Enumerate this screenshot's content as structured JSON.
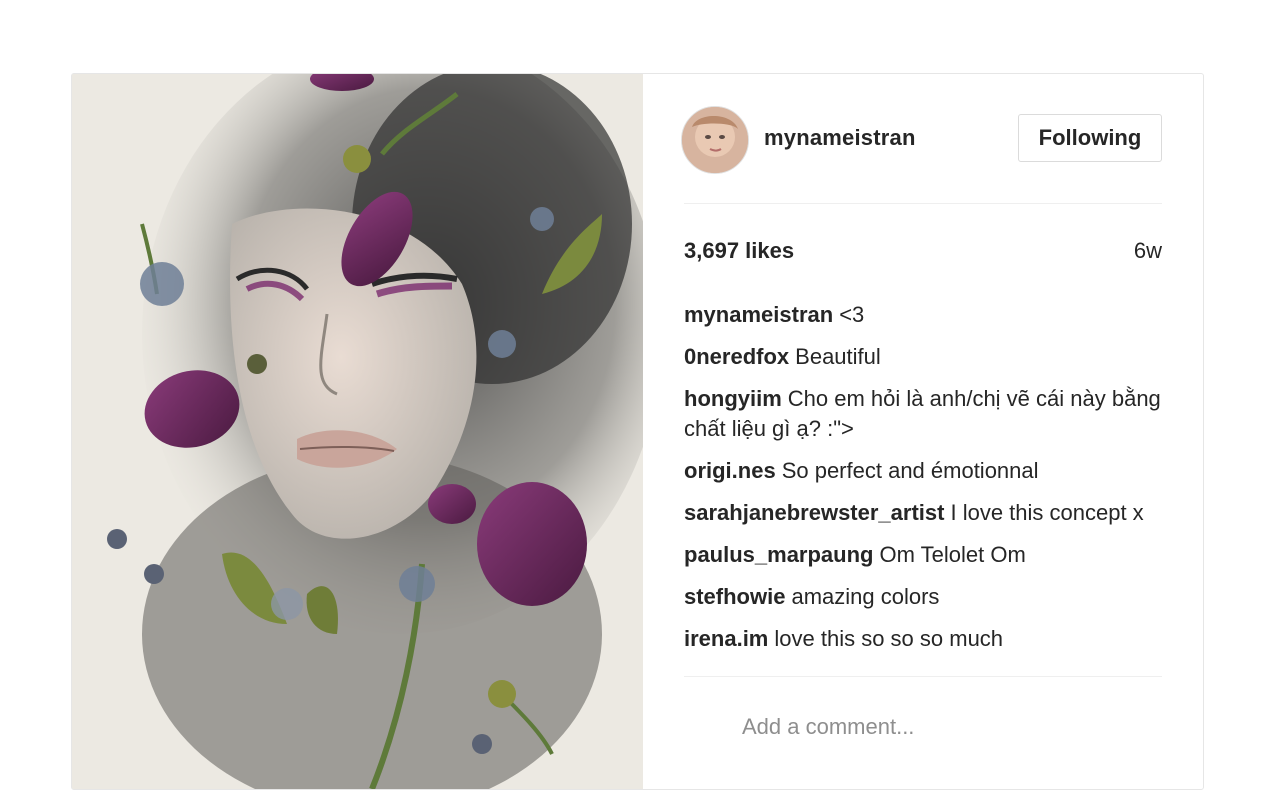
{
  "post": {
    "image_alt": "Watercolor portrait of a woman with pressed flowers and petals",
    "author": {
      "username": "mynameistran",
      "follow_label": "Following"
    },
    "stats": {
      "likes": "3,697 likes",
      "age": "6w"
    },
    "comments": [
      {
        "author": "mynameistran",
        "text": "<3"
      },
      {
        "author": "0neredfox",
        "text": "Beautiful"
      },
      {
        "author": "hongyiim",
        "text": "Cho em hỏi là anh/chị vẽ cái này bằng chất liệu gì ạ? :\">"
      },
      {
        "author": "origi.nes",
        "text": "So perfect and émotionnal"
      },
      {
        "author": "sarahjanebrewster_artist",
        "text": "I love this concept x"
      },
      {
        "author": "paulus_marpaung",
        "text": "Om Telolet Om"
      },
      {
        "author": "stefhowie",
        "text": "amazing colors"
      },
      {
        "author": "irena.im",
        "text": "love this so so so much"
      }
    ],
    "add_comment_placeholder": "Add a comment..."
  },
  "colors": {
    "border": "#e6e6e6",
    "text": "#262626",
    "muted": "#8e8e8e",
    "petal": "#6d2a5c",
    "leaf": "#7b8a3e"
  }
}
